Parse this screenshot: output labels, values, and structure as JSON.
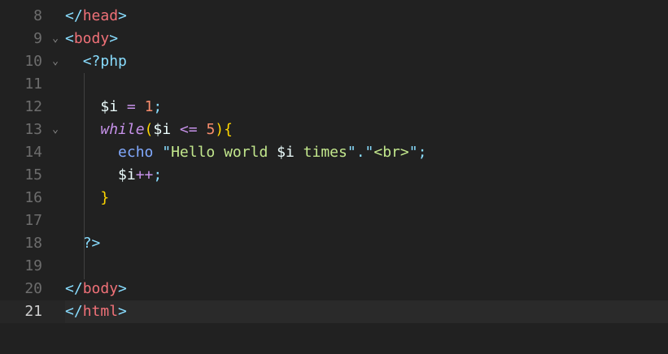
{
  "editor": {
    "top_partial": ">",
    "lines": [
      {
        "num": "8",
        "fold": "",
        "tokens": [
          {
            "t": "</",
            "c": "t-punc"
          },
          {
            "t": "head",
            "c": "t-tag"
          },
          {
            "t": ">",
            "c": "t-punc"
          }
        ]
      },
      {
        "num": "9",
        "fold": "⌄",
        "tokens": [
          {
            "t": "<",
            "c": "t-punc"
          },
          {
            "t": "body",
            "c": "t-tag"
          },
          {
            "t": ">",
            "c": "t-punc"
          }
        ]
      },
      {
        "num": "10",
        "fold": "⌄",
        "tokens": [
          {
            "t": "  ",
            "c": "t-plain"
          },
          {
            "t": "<?php",
            "c": "t-punc"
          }
        ]
      },
      {
        "num": "11",
        "fold": "",
        "tokens": []
      },
      {
        "num": "12",
        "fold": "",
        "tokens": [
          {
            "t": "    ",
            "c": "t-plain"
          },
          {
            "t": "$i",
            "c": "t-var"
          },
          {
            "t": " ",
            "c": "t-plain"
          },
          {
            "t": "=",
            "c": "t-op"
          },
          {
            "t": " ",
            "c": "t-plain"
          },
          {
            "t": "1",
            "c": "t-num"
          },
          {
            "t": ";",
            "c": "t-punc"
          }
        ]
      },
      {
        "num": "13",
        "fold": "⌄",
        "tokens": [
          {
            "t": "    ",
            "c": "t-plain"
          },
          {
            "t": "while",
            "c": "t-kw"
          },
          {
            "t": "(",
            "c": "t-paren"
          },
          {
            "t": "$i",
            "c": "t-var"
          },
          {
            "t": " ",
            "c": "t-plain"
          },
          {
            "t": "<=",
            "c": "t-op"
          },
          {
            "t": " ",
            "c": "t-plain"
          },
          {
            "t": "5",
            "c": "t-num"
          },
          {
            "t": ")",
            "c": "t-paren"
          },
          {
            "t": "{",
            "c": "t-brace"
          }
        ]
      },
      {
        "num": "14",
        "fold": "",
        "tokens": [
          {
            "t": "      ",
            "c": "t-plain"
          },
          {
            "t": "echo",
            "c": "t-fn"
          },
          {
            "t": " ",
            "c": "t-plain"
          },
          {
            "t": "\"",
            "c": "t-punc"
          },
          {
            "t": "Hello world ",
            "c": "t-str"
          },
          {
            "t": "$i",
            "c": "t-var"
          },
          {
            "t": " times",
            "c": "t-str"
          },
          {
            "t": "\"",
            "c": "t-punc"
          },
          {
            "t": ".",
            "c": "t-punc"
          },
          {
            "t": "\"",
            "c": "t-punc"
          },
          {
            "t": "<br>",
            "c": "t-str"
          },
          {
            "t": "\"",
            "c": "t-punc"
          },
          {
            "t": ";",
            "c": "t-punc"
          }
        ]
      },
      {
        "num": "15",
        "fold": "",
        "tokens": [
          {
            "t": "      ",
            "c": "t-plain"
          },
          {
            "t": "$i",
            "c": "t-var"
          },
          {
            "t": "++",
            "c": "t-op"
          },
          {
            "t": ";",
            "c": "t-punc"
          }
        ]
      },
      {
        "num": "16",
        "fold": "",
        "tokens": [
          {
            "t": "    ",
            "c": "t-plain"
          },
          {
            "t": "}",
            "c": "t-brace"
          }
        ]
      },
      {
        "num": "17",
        "fold": "",
        "tokens": []
      },
      {
        "num": "18",
        "fold": "",
        "tokens": [
          {
            "t": "  ",
            "c": "t-plain"
          },
          {
            "t": "?>",
            "c": "t-punc"
          }
        ]
      },
      {
        "num": "19",
        "fold": "",
        "tokens": []
      },
      {
        "num": "20",
        "fold": "",
        "tokens": [
          {
            "t": "</",
            "c": "t-punc"
          },
          {
            "t": "body",
            "c": "t-tag"
          },
          {
            "t": ">",
            "c": "t-punc"
          }
        ]
      },
      {
        "num": "21",
        "fold": "",
        "tokens": [
          {
            "t": "</",
            "c": "t-punc"
          },
          {
            "t": "html",
            "c": "t-tag"
          },
          {
            "t": ">",
            "c": "t-punc"
          }
        ],
        "current": true
      }
    ]
  }
}
